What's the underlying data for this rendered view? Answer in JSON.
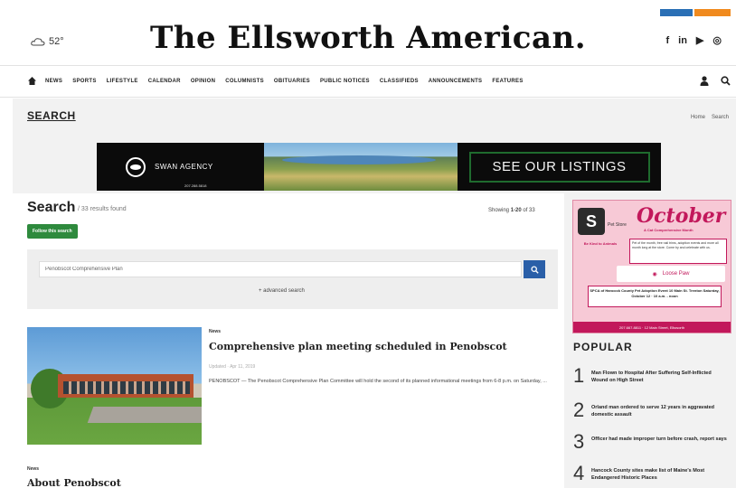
{
  "masthead": {
    "weather": "52°",
    "logo": "The Ellsworth American.",
    "social": [
      "f",
      "in",
      "▶",
      "◎"
    ]
  },
  "nav": {
    "items": [
      "NEWS",
      "SPORTS",
      "LIFESTYLE",
      "CALENDAR",
      "OPINION",
      "COLUMNISTS",
      "OBITUARIES",
      "PUBLIC NOTICES",
      "CLASSIFIEDS",
      "ANNOUNCEMENTS",
      "FEATURES"
    ]
  },
  "page": {
    "heading": "SEARCH",
    "breadcrumb": [
      "Home",
      "Search"
    ]
  },
  "banner_ad": {
    "agency": "SWAN AGENCY",
    "phone": "207.288.5818",
    "cta": "SEE OUR LISTINGS"
  },
  "search": {
    "title": "Search",
    "results_found": "/ 33 results found",
    "showing_prefix": "Showing",
    "showing_range": "1-20",
    "showing_suffix": "of 33",
    "follow_label": "Follow this search",
    "query": "Penobscot Comprehensive Plan",
    "advanced_label": "+ advanced search"
  },
  "articles": [
    {
      "category": "News",
      "title": "Comprehensive plan meeting scheduled in Penobscot",
      "meta": "Updated  ·  Apr 11, 2019",
      "excerpt": "PENOBSCOT — The Penobscot Comprehensive Plan Committee will hold the second of its planned informational meetings from 6-8 p.m. on Saturday, ..."
    },
    {
      "category": "News",
      "title": "About Penobscot"
    }
  ],
  "side_ad": {
    "logo_letter": "S",
    "logo_sub": "Pet Store",
    "month": "October",
    "small": "A Cat Comprehensive Month",
    "left_text": "Be Kind to Animals",
    "list_text": "Pet of the month, free nail trims, adoption events and more all month long at the store. Come by and celebrate with us.",
    "sponsor": "Loose Paw",
    "event": "SPCA of Hancock County Pet Adoption Event 10 Main St. Trenton Saturday, October 12 · 10 a.m. - noon",
    "foot": "207.667.8811 · 12 Main Street, Ellsworth"
  },
  "popular": {
    "title": "POPULAR",
    "items": [
      {
        "num": "1",
        "text": "Man Flown to Hospital After Suffering Self-Inflicted Wound on High Street"
      },
      {
        "num": "2",
        "text": "Orland man ordered to serve 12 years in aggravated domestic assault"
      },
      {
        "num": "3",
        "text": "Officer had made improper turn before crash, report says"
      },
      {
        "num": "4",
        "text": "Hancock County sites make list of Maine's Most Endangered Historic Places"
      }
    ]
  }
}
